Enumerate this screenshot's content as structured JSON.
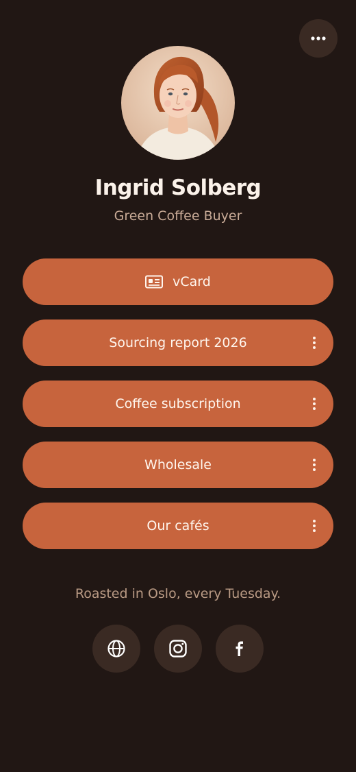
{
  "profile": {
    "name": "Ingrid Solberg",
    "role": "Green Coffee Buyer"
  },
  "menu": {
    "icon": "more-horizontal-icon"
  },
  "links": [
    {
      "label": "vCard",
      "icon": "id-card-icon"
    },
    {
      "label": "Sourcing report 2026",
      "icon": "kebab-menu-icon"
    },
    {
      "label": "Coffee subscription",
      "icon": "kebab-menu-icon"
    },
    {
      "label": "Wholesale",
      "icon": "kebab-menu-icon"
    },
    {
      "label": "Our cafés",
      "icon": "kebab-menu-icon"
    }
  ],
  "footer": {
    "tagline": "Roasted in Oslo, every Tuesday."
  },
  "social": [
    {
      "icon": "globe-icon"
    },
    {
      "icon": "instagram-icon"
    },
    {
      "icon": "facebook-icon"
    }
  ],
  "colors": {
    "background": "#211714",
    "button": "#c7643d",
    "button_text": "#fff6ee",
    "name_text": "#fbf2ea",
    "muted_text": "#c9ab97",
    "circle_button": "#3a2a23"
  }
}
